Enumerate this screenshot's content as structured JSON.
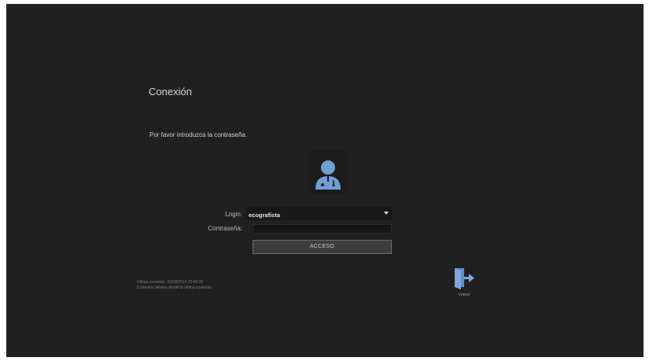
{
  "colors": {
    "background": "#202020",
    "accent_icon": "#6f9fd4",
    "button_fill": "#3d3d3d"
  },
  "dialog": {
    "title": "Conexión",
    "instruction": "Por favor introduzca la contraseña.",
    "avatar_icon": "doctor-user-icon"
  },
  "form": {
    "login_label": "Login:",
    "login_value": "ecografista",
    "password_label": "Contraseña:",
    "password_value": "",
    "access_button": "ACCESO"
  },
  "info": {
    "last_connection": "Última conexión: 26/08/2014 10:40:35",
    "failed_attempts": "0 intentos fallidos desde la última conexión"
  },
  "exit": {
    "icon": "exit-door-icon",
    "label": "Volver"
  }
}
